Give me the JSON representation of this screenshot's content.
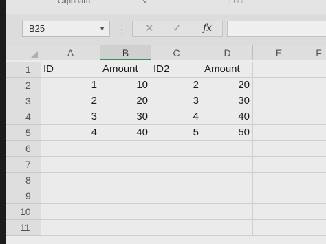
{
  "ribbon": {
    "groups": [
      "Clipboard",
      "Font"
    ]
  },
  "formula_bar": {
    "name_box": "B25",
    "cancel_icon": "✕",
    "enter_icon": "✓",
    "fx_label": "fx",
    "formula": ""
  },
  "columns": [
    "A",
    "B",
    "C",
    "D",
    "E",
    "F"
  ],
  "rows": [
    "1",
    "2",
    "3",
    "4",
    "5",
    "6",
    "7",
    "8",
    "9",
    "10",
    "11"
  ],
  "cells": {
    "A1": "ID",
    "B1": "Amount",
    "C1": "ID2",
    "D1": "Amount",
    "A2": "1",
    "B2": "10",
    "C2": "2",
    "D2": "20",
    "A3": "2",
    "B3": "20",
    "C3": "3",
    "D3": "30",
    "A4": "3",
    "B4": "30",
    "C4": "4",
    "D4": "40",
    "A5": "4",
    "B5": "40",
    "C5": "5",
    "D5": "50"
  },
  "selected_column": "B",
  "colors": {
    "selection_accent": "#3f8f5a"
  }
}
